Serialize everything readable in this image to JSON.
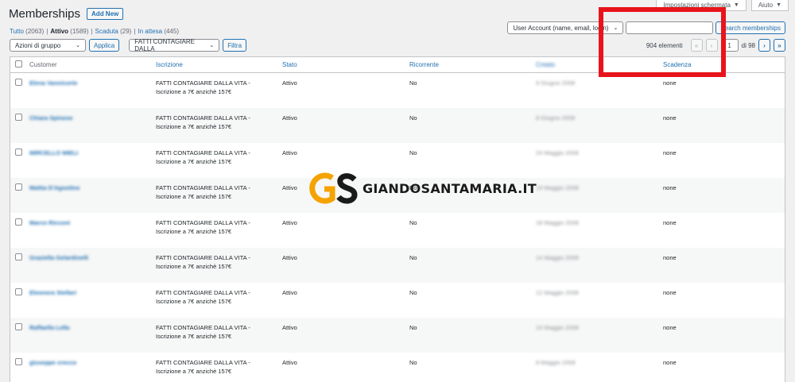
{
  "screen_options": {
    "label": "Impostazioni schermata",
    "help": "Aiuto"
  },
  "page": {
    "title": "Memberships",
    "add_new": "Add New"
  },
  "filters": [
    {
      "label": "Tutto",
      "count": "(2063)",
      "current": false
    },
    {
      "label": "Attivo",
      "count": "(1589)",
      "current": true
    },
    {
      "label": "Scaduta",
      "count": "(29)",
      "current": false
    },
    {
      "label": "In attesa",
      "count": "(445)",
      "current": false
    }
  ],
  "search": {
    "field_select": "User Account (name, email, login)",
    "value": "",
    "button": "Search memberships"
  },
  "bulk": {
    "select": "Azioni di gruppo",
    "apply": "Applica"
  },
  "filter_bar": {
    "select": "FATTI CONTAGIARE DALLA",
    "button": "Filtra"
  },
  "pagination": {
    "count_text": "904 elementi",
    "first": "«",
    "prev": "‹",
    "current_page": "1",
    "total_text": "di 98",
    "next": "›",
    "last": "»"
  },
  "table": {
    "columns": [
      "Customer",
      "Iscrizione",
      "Stato",
      "Ricorrente",
      "Creato",
      "Scadenza"
    ],
    "rows": [
      {
        "customer": "Elena Vannicorte",
        "plan": "FATTI CONTAGIARE DALLA VITA -",
        "plan2": "Iscrizione a 7€ anzichè 157€",
        "status": "Attivo",
        "recurring": "No",
        "created": "9 Giugno 2008",
        "expiry": "none"
      },
      {
        "customer": "Chiara Spinose",
        "plan": "FATTI CONTAGIARE DALLA VITA -",
        "plan2": "Iscrizione a 7€ anzichè 157€",
        "status": "Attivo",
        "recurring": "No",
        "created": "8 Giugno 2008",
        "expiry": "none"
      },
      {
        "customer": "MIRCELLO MIELI",
        "plan": "FATTI CONTAGIARE DALLA VITA -",
        "plan2": "Iscrizione a 7€ anzichè 157€",
        "status": "Attivo",
        "recurring": "No",
        "created": "24 Maggio 2008",
        "expiry": "none"
      },
      {
        "customer": "Mattia D'Agostino",
        "plan": "FATTI CONTAGIARE DALLA VITA -",
        "plan2": "Iscrizione a 7€ anzichè 157€",
        "status": "Attivo",
        "recurring": "No",
        "created": "19 Maggio 2008",
        "expiry": "none"
      },
      {
        "customer": "Marco Ricconi",
        "plan": "FATTI CONTAGIARE DALLA VITA -",
        "plan2": "Iscrizione a 7€ anzichè 157€",
        "status": "Attivo",
        "recurring": "No",
        "created": "18 Maggio 2008",
        "expiry": "none"
      },
      {
        "customer": "Graziella Gelardinelli",
        "plan": "FATTI CONTAGIARE DALLA VITA -",
        "plan2": "Iscrizione a 7€ anzichè 157€",
        "status": "Attivo",
        "recurring": "No",
        "created": "14 Maggio 2008",
        "expiry": "none"
      },
      {
        "customer": "Eleonora Stellari",
        "plan": "FATTI CONTAGIARE DALLA VITA -",
        "plan2": "Iscrizione a 7€ anzichè 157€",
        "status": "Attivo",
        "recurring": "No",
        "created": "12 Maggio 2008",
        "expiry": "none"
      },
      {
        "customer": "Raffaella Lella",
        "plan": "FATTI CONTAGIARE DALLA VITA -",
        "plan2": "Iscrizione a 7€ anzichè 157€",
        "status": "Attivo",
        "recurring": "No",
        "created": "10 Maggio 2008",
        "expiry": "none"
      },
      {
        "customer": "giuseppe crecco",
        "plan": "FATTI CONTAGIARE DALLA VITA -",
        "plan2": "Iscrizione a 7€ anzichè 157€",
        "status": "Attivo",
        "recurring": "No",
        "created": "8 Maggio 2008",
        "expiry": "none"
      }
    ]
  },
  "watermark": {
    "text": "GIANDOSANTAMARIA.IT",
    "logo_color": "#f4a300"
  },
  "colors": {
    "accent": "#2271b1",
    "highlight": "#e8141b",
    "background": "#f0f0f1"
  }
}
